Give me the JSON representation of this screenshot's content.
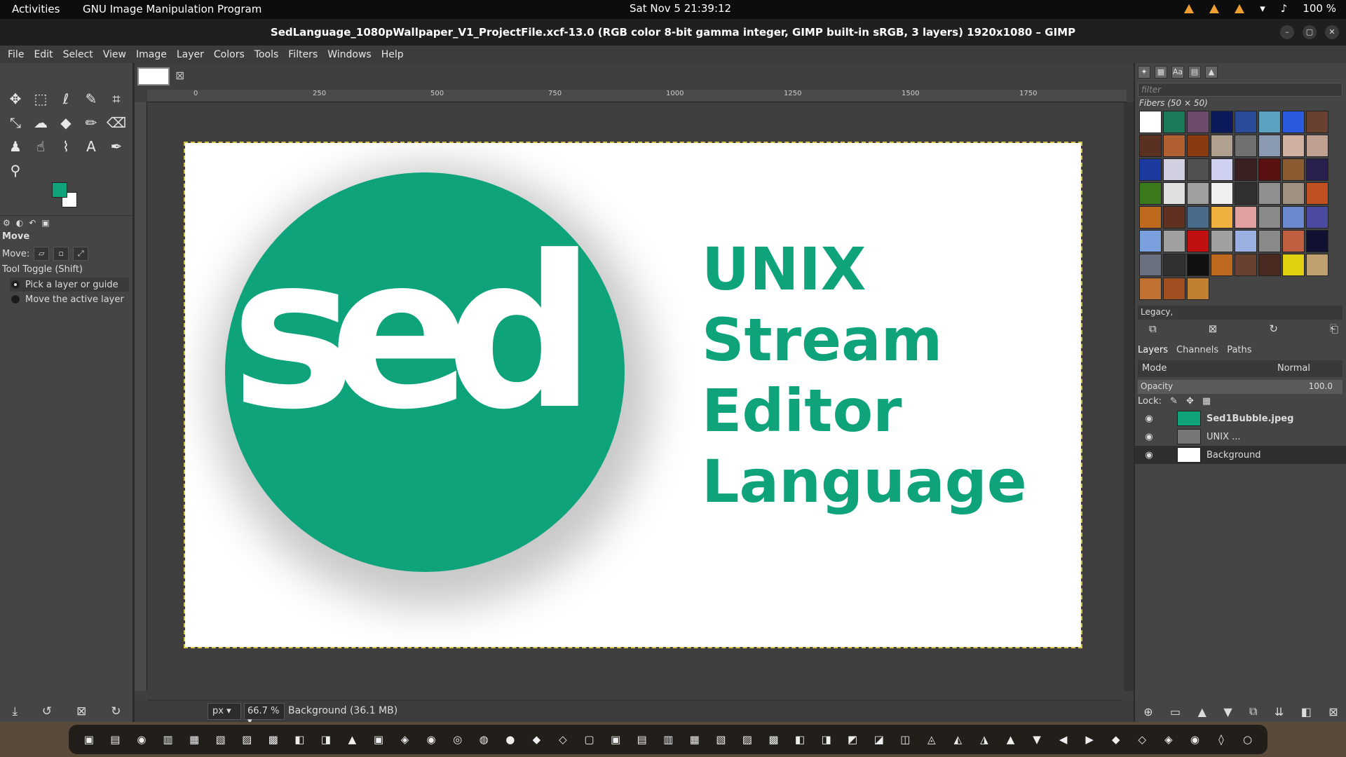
{
  "topbar": {
    "activities": "Activities",
    "app_name": "GNU Image Manipulation Program",
    "clock": "Sat Nov 5  21:39:12",
    "battery": "100 %"
  },
  "window": {
    "title": "SedLanguage_1080pWallpaper_V1_ProjectFile.xcf-13.0 (RGB color 8-bit gamma integer, GIMP built-in sRGB, 3 layers) 1920x1080 – GIMP"
  },
  "menu": [
    "File",
    "Edit",
    "Select",
    "View",
    "Image",
    "Layer",
    "Colors",
    "Tools",
    "Filters",
    "Windows",
    "Help"
  ],
  "tool_options": {
    "title": "Move",
    "move_label": "Move:",
    "toggle_label": "Tool Toggle  (Shift)",
    "option1": "Pick a layer or guide",
    "option2": "Move the active layer"
  },
  "colors": {
    "foreground": "#0ea37b",
    "background": "#ffffff"
  },
  "rulers": {
    "ticks": [
      "0",
      "250",
      "500",
      "750",
      "1000",
      "1250",
      "1500",
      "1750"
    ]
  },
  "canvas": {
    "logo_text": "sed",
    "headline_lines": [
      "UNIX",
      "Stream",
      "Editor",
      "Language"
    ],
    "accent": "#0ea37b"
  },
  "status": {
    "unit": "px",
    "zoom": "66.7 %",
    "info": "Background (36.1 MB)"
  },
  "patterns": {
    "filter_placeholder": "filter",
    "current": "Fibers (50 × 50)",
    "tag": "Legacy,",
    "swatches": [
      "#ffffff",
      "#1a7a5a",
      "#6b4a6b",
      "#0a1a5a",
      "#2a4a9a",
      "#5aa0c0",
      "#2a5ae0",
      "#6a4030",
      "#5a3020",
      "#b06030",
      "#8a3a10",
      "#b0a090",
      "#707070",
      "#8a9ab0",
      "#d0b0a0",
      "#c0a090",
      "#1a3aa0",
      "#d0d0e0",
      "#505050",
      "#d0d0f0",
      "#3a2020",
      "#5a1010",
      "#8a5a30",
      "#2a2050",
      "#3a7a1a",
      "#e0e0e0",
      "#a0a0a0",
      "#f0f0f0",
      "#303030",
      "#909090",
      "#a09080",
      "#c05020",
      "#c06a20",
      "#603020",
      "#4a6a8a",
      "#f0b040",
      "#e0a0a0",
      "#8a8a8a",
      "#6a8ad0",
      "#4a4aa0",
      "#7aa0e0",
      "#a0a0a0",
      "#c01010",
      "#a0a0a0",
      "#9ab0e0",
      "#8a8a8a",
      "#c06040",
      "#101030",
      "#6a7080",
      "#303030",
      "#101010",
      "#c06a20",
      "#6a4030",
      "#4a2a20",
      "#e0d010",
      "#c0a070",
      "#c07030",
      "#a05020",
      "#c08030"
    ]
  },
  "layers_panel": {
    "tabs": [
      "Layers",
      "Channels",
      "Paths"
    ],
    "mode_label": "Mode",
    "mode_value": "Normal",
    "opacity_label": "Opacity",
    "opacity_value": "100.0",
    "lock_label": "Lock:",
    "layers": [
      "Sed1Bubble.jpeg",
      "UNIX ...",
      "Background"
    ]
  }
}
